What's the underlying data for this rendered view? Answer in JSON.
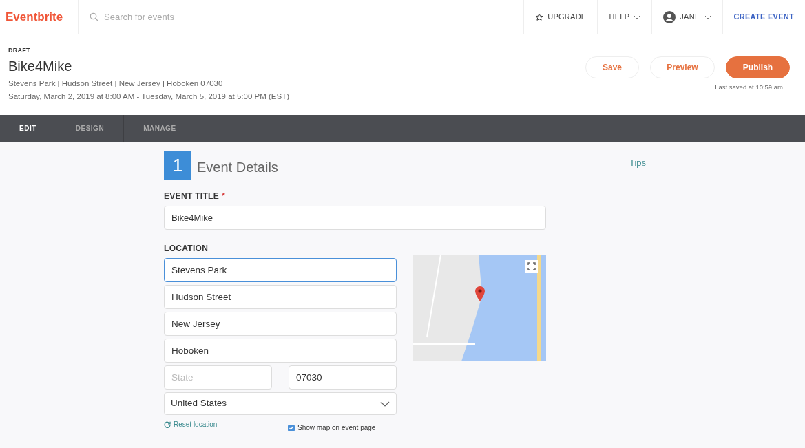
{
  "topbar": {
    "logo": "Eventbrite",
    "search": {
      "placeholder": "Search for events"
    },
    "items": [
      {
        "kind": "upgrade",
        "label": "UPGRADE"
      },
      {
        "kind": "menu",
        "label": "HELP"
      },
      {
        "kind": "user",
        "label": "JANE"
      },
      {
        "kind": "link",
        "label": "CREATE EVENT"
      }
    ]
  },
  "event": {
    "status": "DRAFT",
    "title": "Bike4Mike",
    "location": "Stevens Park | Hudson Street | New Jersey | Hoboken 07030",
    "dates": "Saturday, March 2, 2019 at 8:00 AM - Tuesday, March 5, 2019 at 5:00 PM (EST)"
  },
  "actions": [
    {
      "label": "Save",
      "primary": false
    },
    {
      "label": "Preview",
      "primary": false
    },
    {
      "label": "Publish",
      "primary": true
    }
  ],
  "last_saved": "Last saved at 10:59 am",
  "tabs": [
    {
      "label": "EDIT",
      "selected": true
    },
    {
      "label": "DESIGN",
      "selected": false
    },
    {
      "label": "MANAGE",
      "selected": false
    }
  ],
  "section": {
    "number": "1",
    "title": "Event Details",
    "tips": "Tips"
  },
  "event_title": {
    "label": "EVENT TITLE",
    "required_mark": "*",
    "value": "Bike4Mike"
  },
  "location": {
    "label": "LOCATION",
    "fields": [
      {
        "value": "Stevens Park",
        "focused": true
      },
      {
        "value": "Hudson Street",
        "focused": false
      },
      {
        "value": "New Jersey",
        "focused": false
      },
      {
        "value": "Hoboken",
        "focused": false
      }
    ],
    "state": {
      "placeholder": "State"
    },
    "zip": {
      "value": "07030"
    },
    "country": {
      "value": "United States"
    },
    "reset": "Reset location",
    "show_map": {
      "label": "Show map on event page",
      "checked": true
    }
  }
}
